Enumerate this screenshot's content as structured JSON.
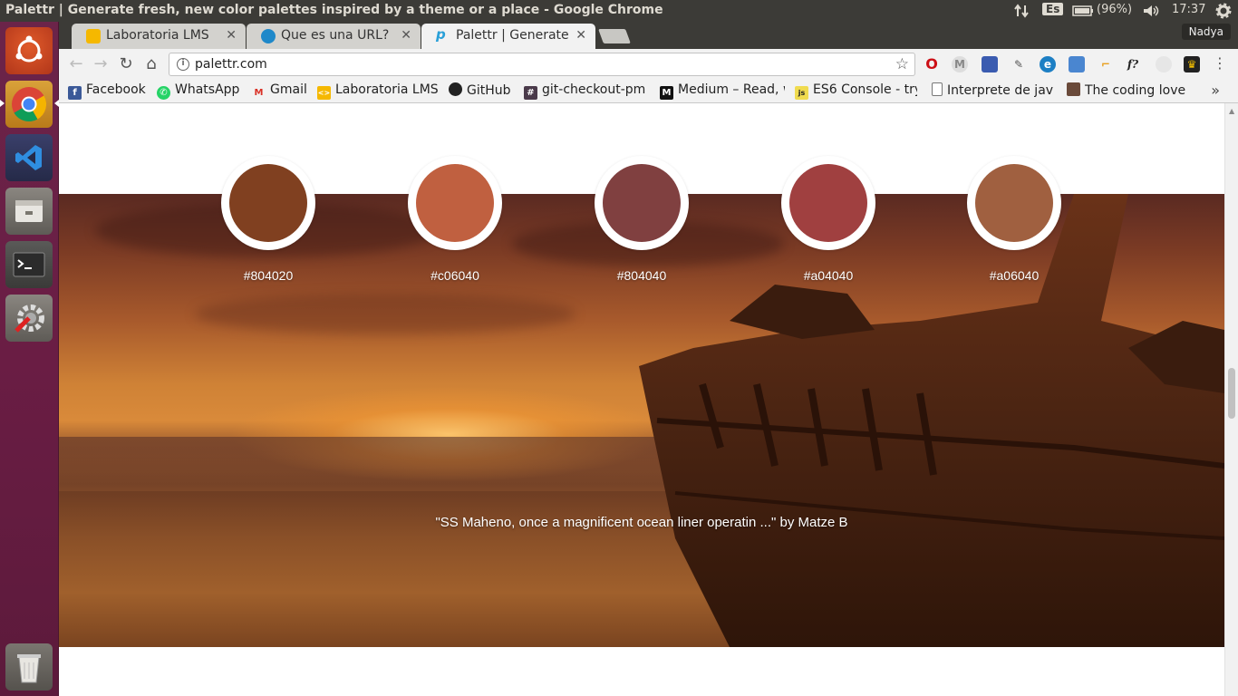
{
  "window": {
    "title": "Palettr | Generate fresh, new color palettes inspired by a theme or a place - Google Chrome"
  },
  "panel": {
    "keyboard_layout": "Es",
    "battery": "(96%)",
    "time": "17:37",
    "user": "Nadya"
  },
  "launcher": {
    "items": [
      {
        "name": "ubuntu-dash-icon"
      },
      {
        "name": "chrome-icon"
      },
      {
        "name": "vscode-icon"
      },
      {
        "name": "files-icon"
      },
      {
        "name": "terminal-icon"
      },
      {
        "name": "system-settings-icon"
      },
      {
        "name": "trash-icon"
      }
    ]
  },
  "tabs": [
    {
      "label": "Laboratoria LMS",
      "favicon_color": "#f5b800"
    },
    {
      "label": "Que es una URL?",
      "favicon_color": "#1e88c9"
    },
    {
      "label": "Palettr | Generate fr",
      "favicon_color": "#2aa0d8"
    }
  ],
  "toolbar": {
    "url": "palettr.com"
  },
  "bookmarks": [
    {
      "label": "Facebook",
      "icon": "facebook-icon",
      "color": "#3b5998",
      "glyph": "f"
    },
    {
      "label": "WhatsApp",
      "icon": "whatsapp-icon",
      "color": "#25d366",
      "glyph": "✆"
    },
    {
      "label": "Gmail",
      "icon": "gmail-icon",
      "color": "#d93025",
      "glyph": "M"
    },
    {
      "label": "Laboratoria LMS",
      "icon": "laboratoria-icon",
      "color": "#f5b800",
      "glyph": "<>"
    },
    {
      "label": "GitHub",
      "icon": "github-icon",
      "color": "#222222",
      "glyph": "●"
    },
    {
      "label": "git-checkout-pm",
      "icon": "hash-icon",
      "color": "#4a3a4a",
      "glyph": "#"
    },
    {
      "label": "Medium – Read, w",
      "icon": "medium-icon",
      "color": "#111111",
      "glyph": "M"
    },
    {
      "label": "ES6 Console - try",
      "icon": "es6-icon",
      "color": "#f0db4f",
      "glyph": "js"
    },
    {
      "label": "Interprete de java",
      "icon": "page-icon",
      "color": "#ffffff",
      "glyph": ""
    },
    {
      "label": "The coding love",
      "icon": "coding-love-icon",
      "color": "#6a4a3a",
      "glyph": "▲"
    }
  ],
  "palette": {
    "swatches": [
      {
        "hex": "#804020",
        "color": "#804020"
      },
      {
        "hex": "#c06040",
        "color": "#c06040"
      },
      {
        "hex": "#804040",
        "color": "#804040"
      },
      {
        "hex": "#a04040",
        "color": "#a04040"
      },
      {
        "hex": "#a06040",
        "color": "#a06040"
      }
    ],
    "caption": "\"SS Maheno, once a magnificent ocean liner operatin ...\" by Matze B"
  }
}
